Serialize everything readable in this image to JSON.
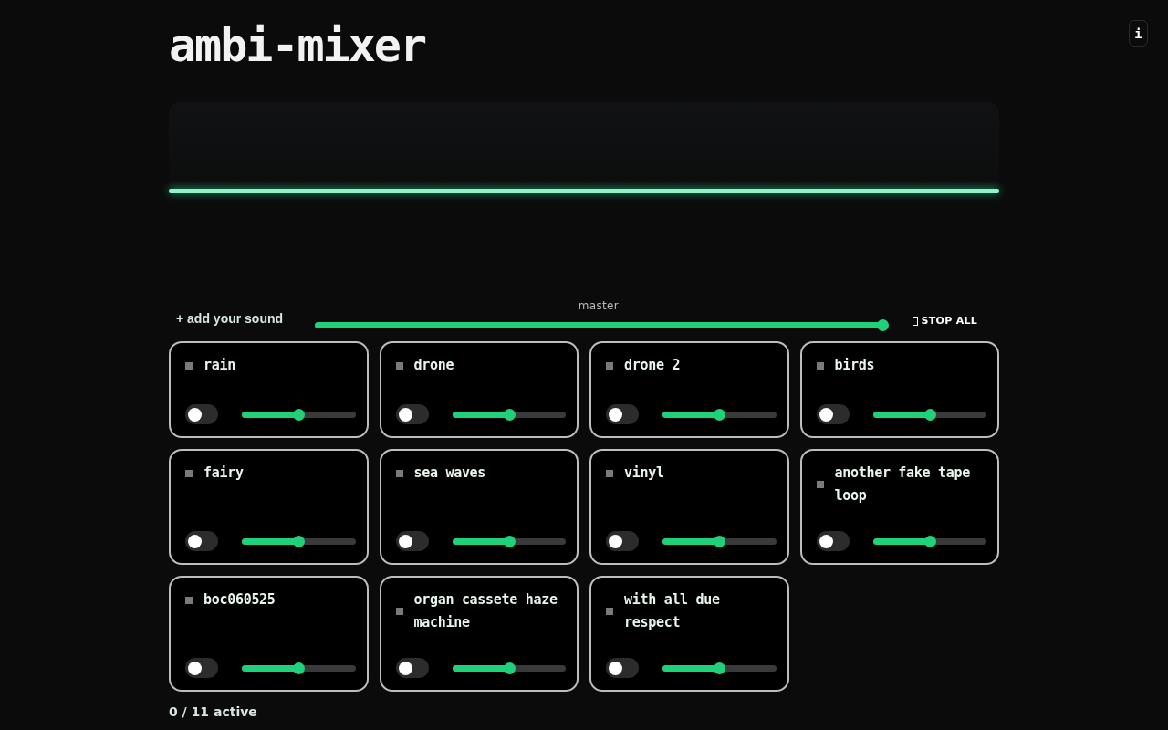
{
  "title": "ambi-mixer",
  "info_button": "i",
  "controls": {
    "add_sound": "+ add your sound",
    "master": {
      "label": "master",
      "level": 1.0
    },
    "stop_all": "STOP ALL"
  },
  "sounds": [
    {
      "name": "rain",
      "on": false,
      "level": 0.5
    },
    {
      "name": "drone",
      "on": false,
      "level": 0.5
    },
    {
      "name": "drone 2",
      "on": false,
      "level": 0.5
    },
    {
      "name": "birds",
      "on": false,
      "level": 0.5
    },
    {
      "name": "fairy",
      "on": false,
      "level": 0.5
    },
    {
      "name": "sea waves",
      "on": false,
      "level": 0.5
    },
    {
      "name": "vinyl",
      "on": false,
      "level": 0.5
    },
    {
      "name": "another fake tape loop",
      "on": false,
      "level": 0.5
    },
    {
      "name": "boc060525",
      "on": false,
      "level": 0.5
    },
    {
      "name": "organ cassete haze machine",
      "on": false,
      "level": 0.5
    },
    {
      "name": "with all due respect",
      "on": false,
      "level": 0.5
    }
  ],
  "status": "0 / 11 active"
}
